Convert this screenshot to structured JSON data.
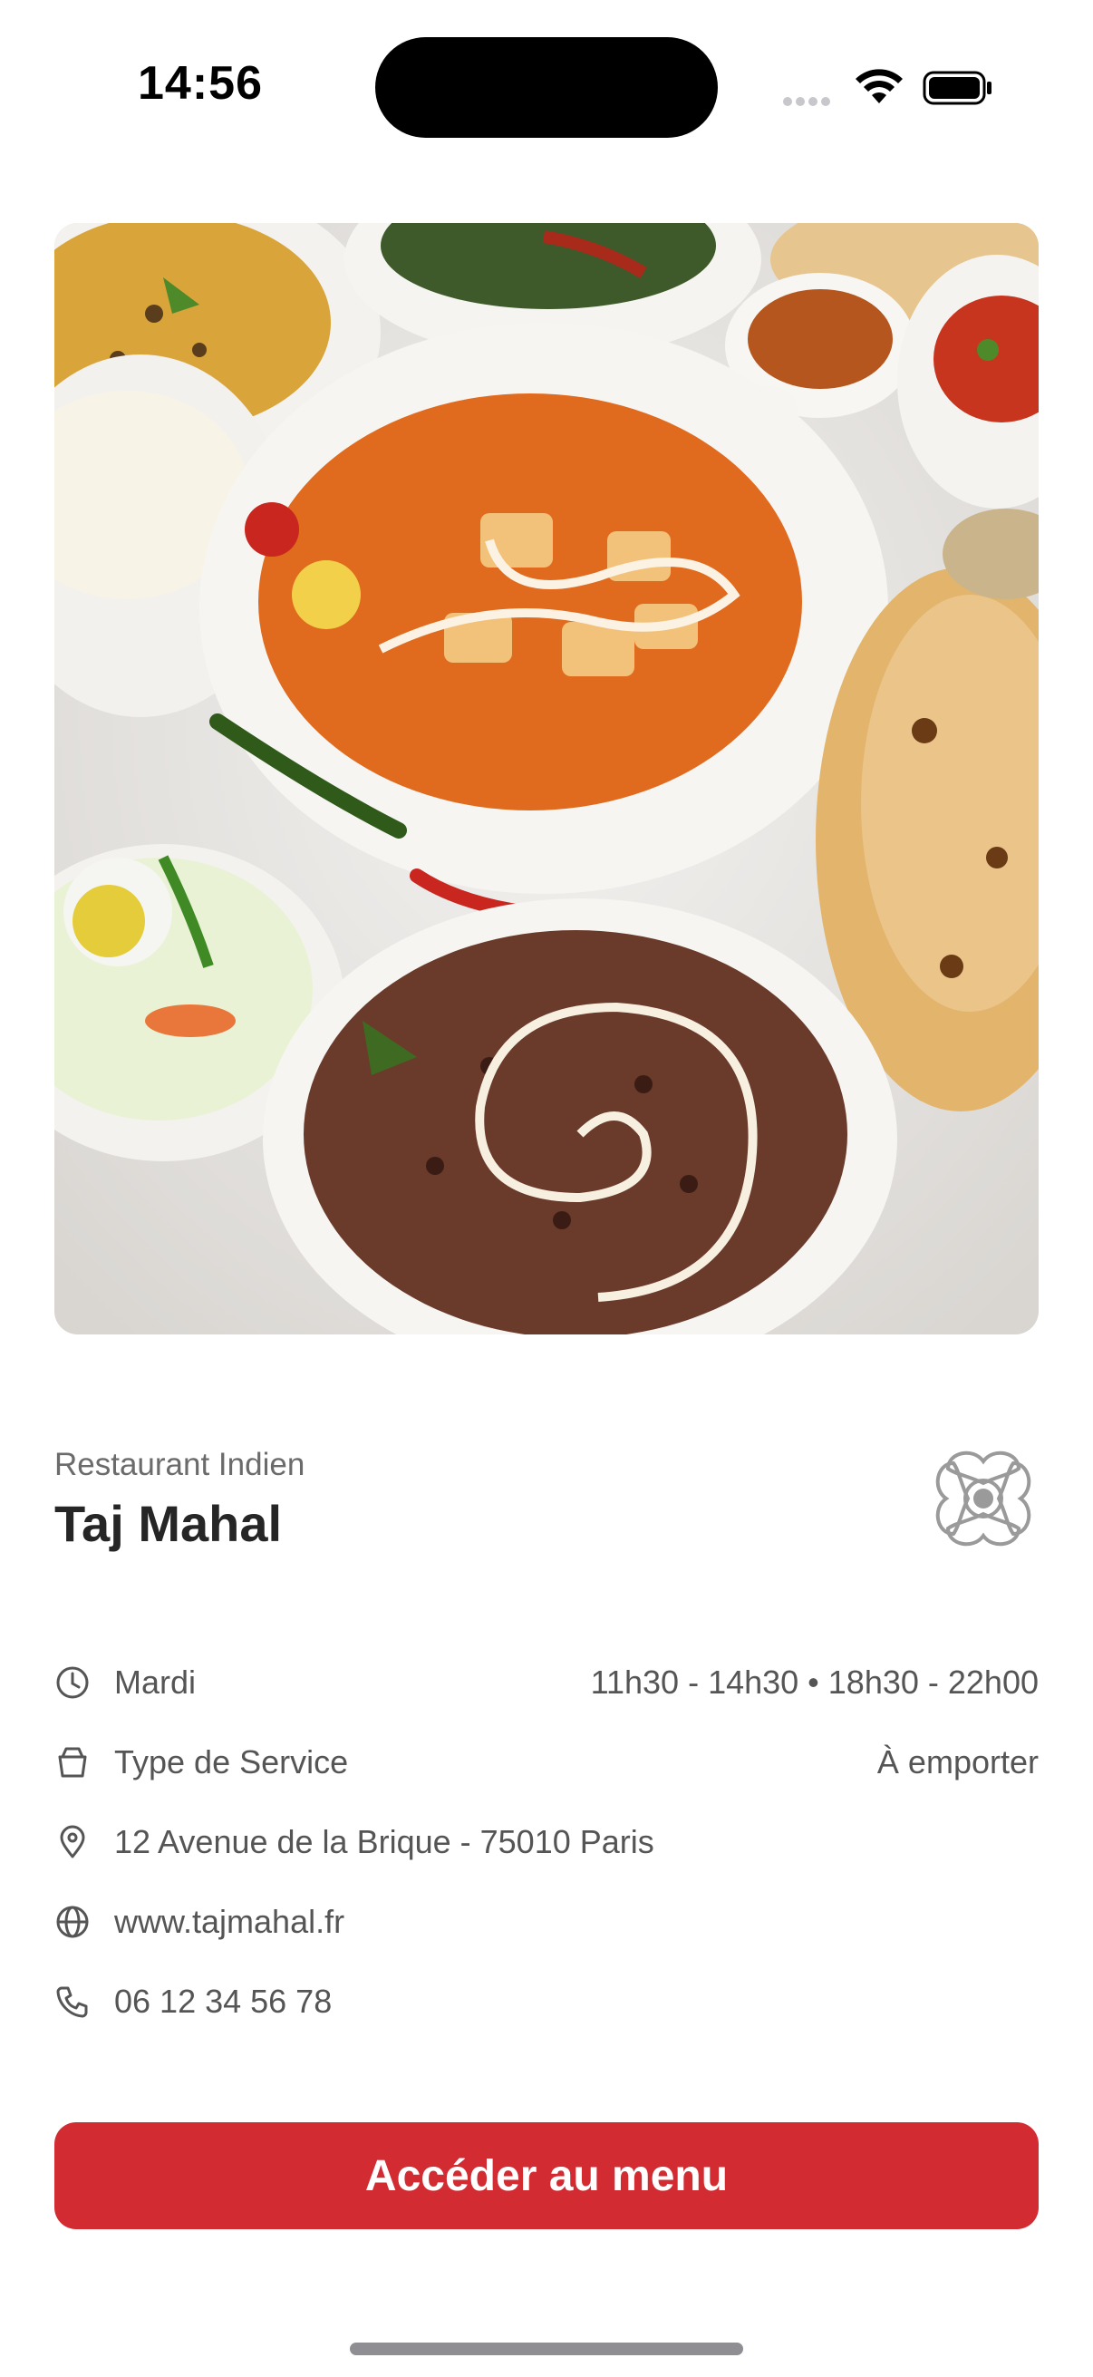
{
  "status_bar": {
    "time": "14:56"
  },
  "restaurant": {
    "category": "Restaurant Indien",
    "name": "Taj Mahal",
    "hero_image": "indian-food-spread"
  },
  "info": {
    "hours": {
      "icon": "clock-icon",
      "label": "Mardi",
      "value": "11h30 - 14h30 • 18h30 - 22h00"
    },
    "service": {
      "icon": "bag-icon",
      "label": "Type de Service",
      "value": "À emporter"
    },
    "address": {
      "icon": "location-pin-icon",
      "label": "12  Avenue de la Brique - 75010 Paris"
    },
    "website": {
      "icon": "globe-icon",
      "label": "www.tajmahal.fr"
    },
    "phone": {
      "icon": "phone-icon",
      "label": "06 12 34 56 78"
    }
  },
  "cta": {
    "label": "Accéder au menu"
  },
  "colors": {
    "accent": "#d22b32",
    "text_primary": "#262626",
    "text_secondary": "#555555"
  }
}
